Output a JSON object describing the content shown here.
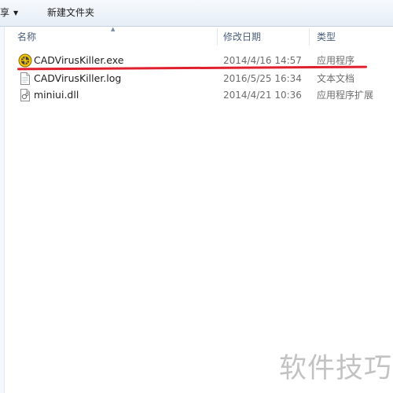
{
  "toolbar": {
    "share_label": "共享",
    "new_folder_label": "新建文件夹"
  },
  "columns": {
    "name": "名称",
    "date": "修改日期",
    "type": "类型"
  },
  "files": [
    {
      "name": "CADVirusKiller.exe",
      "date": "2014/4/16 14:57",
      "type": "应用程序",
      "icon": "exe-icon"
    },
    {
      "name": "CADVirusKiller.log",
      "date": "2016/5/25 16:34",
      "type": "文本文档",
      "icon": "text-document-icon"
    },
    {
      "name": "miniui.dll",
      "date": "2014/4/21 10:36",
      "type": "应用程序扩展",
      "icon": "dll-icon"
    }
  ],
  "watermark": "软件技巧",
  "colors": {
    "highlight_underline": "#e0202e",
    "toolbar_top": "#f7fafd",
    "toolbar_bottom": "#e5edf6"
  }
}
